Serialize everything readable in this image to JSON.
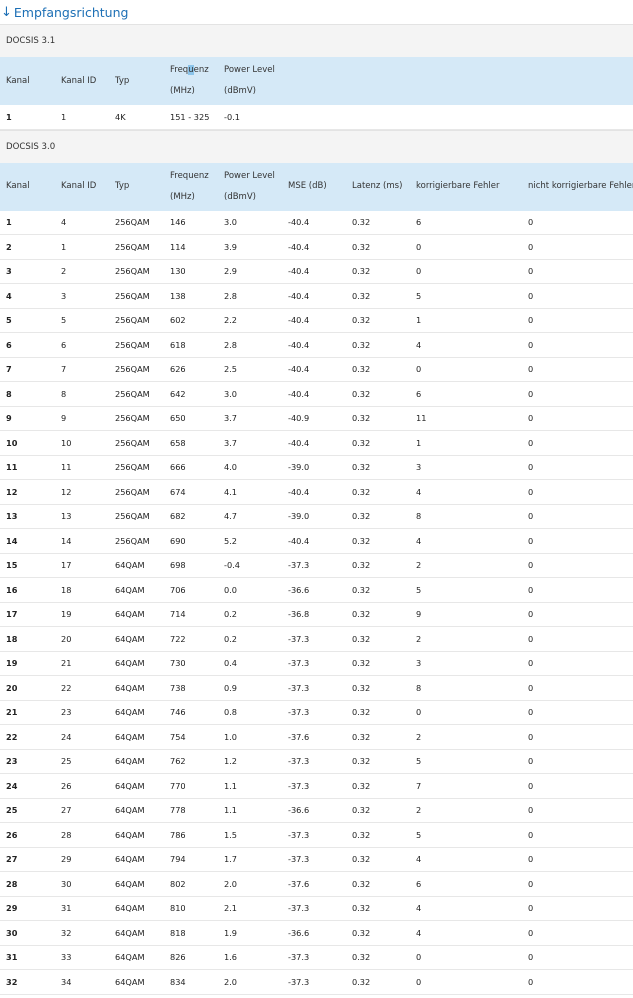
{
  "heading": {
    "arrow": "↓",
    "title": "Empfangsrichtung"
  },
  "docsis31": {
    "title": "DOCSIS 3.1",
    "columns": [
      "Kanal",
      "Kanal ID",
      "Typ",
      [
        "Freq",
        "u",
        "enz"
      ],
      "(MHz)",
      "Power Level",
      "(dBmV)"
    ],
    "rows": [
      [
        "1",
        "1",
        "4K",
        "151 - 325",
        "-0.1"
      ]
    ]
  },
  "docsis30": {
    "title": "DOCSIS 3.0",
    "columns": [
      "Kanal",
      "Kanal ID",
      "Typ",
      "Frequenz",
      "(MHz)",
      "Power Level",
      "(dBmV)",
      "MSE (dB)",
      "Latenz (ms)",
      "korrigierbare Fehler",
      "nicht korrigierbare Fehler"
    ],
    "rows": [
      [
        "1",
        "4",
        "256QAM",
        "146",
        "3.0",
        "-40.4",
        "0.32",
        "6",
        "0"
      ],
      [
        "2",
        "1",
        "256QAM",
        "114",
        "3.9",
        "-40.4",
        "0.32",
        "0",
        "0"
      ],
      [
        "3",
        "2",
        "256QAM",
        "130",
        "2.9",
        "-40.4",
        "0.32",
        "0",
        "0"
      ],
      [
        "4",
        "3",
        "256QAM",
        "138",
        "2.8",
        "-40.4",
        "0.32",
        "5",
        "0"
      ],
      [
        "5",
        "5",
        "256QAM",
        "602",
        "2.2",
        "-40.4",
        "0.32",
        "1",
        "0"
      ],
      [
        "6",
        "6",
        "256QAM",
        "618",
        "2.8",
        "-40.4",
        "0.32",
        "4",
        "0"
      ],
      [
        "7",
        "7",
        "256QAM",
        "626",
        "2.5",
        "-40.4",
        "0.32",
        "0",
        "0"
      ],
      [
        "8",
        "8",
        "256QAM",
        "642",
        "3.0",
        "-40.4",
        "0.32",
        "6",
        "0"
      ],
      [
        "9",
        "9",
        "256QAM",
        "650",
        "3.7",
        "-40.9",
        "0.32",
        "11",
        "0"
      ],
      [
        "10",
        "10",
        "256QAM",
        "658",
        "3.7",
        "-40.4",
        "0.32",
        "1",
        "0"
      ],
      [
        "11",
        "11",
        "256QAM",
        "666",
        "4.0",
        "-39.0",
        "0.32",
        "3",
        "0"
      ],
      [
        "12",
        "12",
        "256QAM",
        "674",
        "4.1",
        "-40.4",
        "0.32",
        "4",
        "0"
      ],
      [
        "13",
        "13",
        "256QAM",
        "682",
        "4.7",
        "-39.0",
        "0.32",
        "8",
        "0"
      ],
      [
        "14",
        "14",
        "256QAM",
        "690",
        "5.2",
        "-40.4",
        "0.32",
        "4",
        "0"
      ],
      [
        "15",
        "17",
        "64QAM",
        "698",
        "-0.4",
        "-37.3",
        "0.32",
        "2",
        "0"
      ],
      [
        "16",
        "18",
        "64QAM",
        "706",
        "0.0",
        "-36.6",
        "0.32",
        "5",
        "0"
      ],
      [
        "17",
        "19",
        "64QAM",
        "714",
        "0.2",
        "-36.8",
        "0.32",
        "9",
        "0"
      ],
      [
        "18",
        "20",
        "64QAM",
        "722",
        "0.2",
        "-37.3",
        "0.32",
        "2",
        "0"
      ],
      [
        "19",
        "21",
        "64QAM",
        "730",
        "0.4",
        "-37.3",
        "0.32",
        "3",
        "0"
      ],
      [
        "20",
        "22",
        "64QAM",
        "738",
        "0.9",
        "-37.3",
        "0.32",
        "8",
        "0"
      ],
      [
        "21",
        "23",
        "64QAM",
        "746",
        "0.8",
        "-37.3",
        "0.32",
        "0",
        "0"
      ],
      [
        "22",
        "24",
        "64QAM",
        "754",
        "1.0",
        "-37.6",
        "0.32",
        "2",
        "0"
      ],
      [
        "23",
        "25",
        "64QAM",
        "762",
        "1.2",
        "-37.3",
        "0.32",
        "5",
        "0"
      ],
      [
        "24",
        "26",
        "64QAM",
        "770",
        "1.1",
        "-37.3",
        "0.32",
        "7",
        "0"
      ],
      [
        "25",
        "27",
        "64QAM",
        "778",
        "1.1",
        "-36.6",
        "0.32",
        "2",
        "0"
      ],
      [
        "26",
        "28",
        "64QAM",
        "786",
        "1.5",
        "-37.3",
        "0.32",
        "5",
        "0"
      ],
      [
        "27",
        "29",
        "64QAM",
        "794",
        "1.7",
        "-37.3",
        "0.32",
        "4",
        "0"
      ],
      [
        "28",
        "30",
        "64QAM",
        "802",
        "2.0",
        "-37.6",
        "0.32",
        "6",
        "0"
      ],
      [
        "29",
        "31",
        "64QAM",
        "810",
        "2.1",
        "-37.3",
        "0.32",
        "4",
        "0"
      ],
      [
        "30",
        "32",
        "64QAM",
        "818",
        "1.9",
        "-36.6",
        "0.32",
        "4",
        "0"
      ],
      [
        "31",
        "33",
        "64QAM",
        "826",
        "1.6",
        "-37.3",
        "0.32",
        "0",
        "0"
      ],
      [
        "32",
        "34",
        "64QAM",
        "834",
        "2.0",
        "-37.3",
        "0.32",
        "0",
        "0"
      ]
    ]
  },
  "colors": {
    "link": "#1c6fb5",
    "header_bg": "#d5e9f7",
    "section_bg": "#f4f4f4",
    "text_highlight": "#8bc4ea"
  }
}
